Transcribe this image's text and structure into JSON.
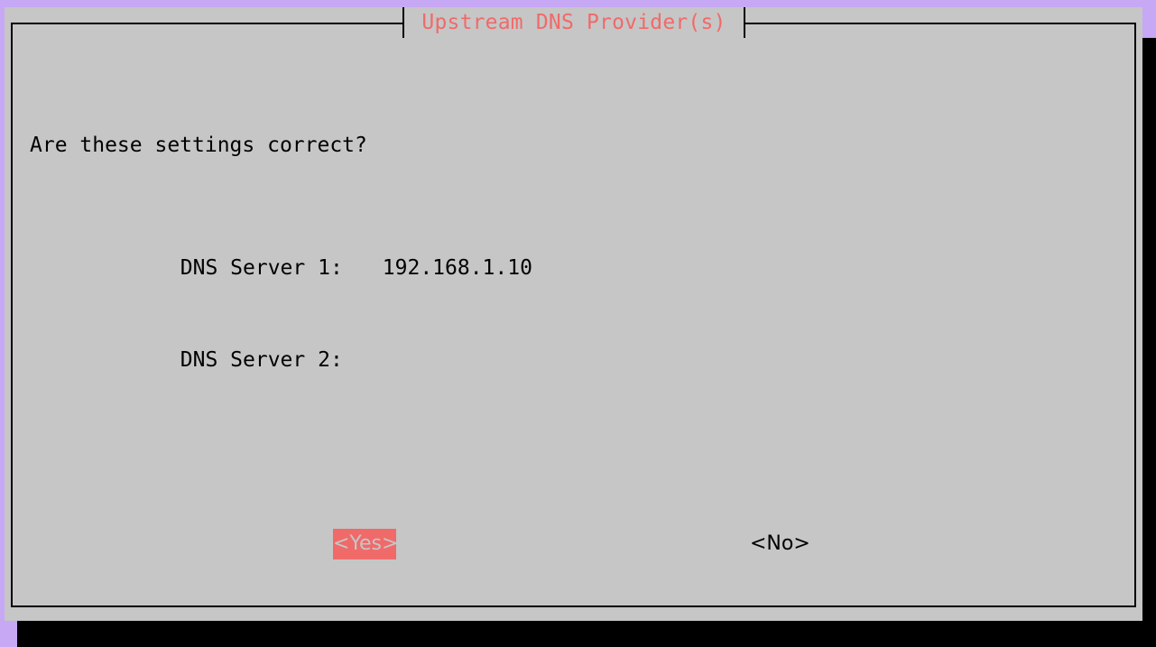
{
  "dialog": {
    "title": "Upstream DNS Provider(s)",
    "question": "Are these settings correct?",
    "dns_server_1": {
      "label": "DNS Server 1:",
      "value": "192.168.1.10"
    },
    "dns_server_2": {
      "label": "DNS Server 2:",
      "value": ""
    },
    "buttons": {
      "yes": "<Yes>",
      "no": "<No>",
      "selected": "yes"
    }
  },
  "colors": {
    "background": "#c7a8f5",
    "dialog": "#c6c6c6",
    "accent": "#f06a6a",
    "shadow": "#000000"
  }
}
